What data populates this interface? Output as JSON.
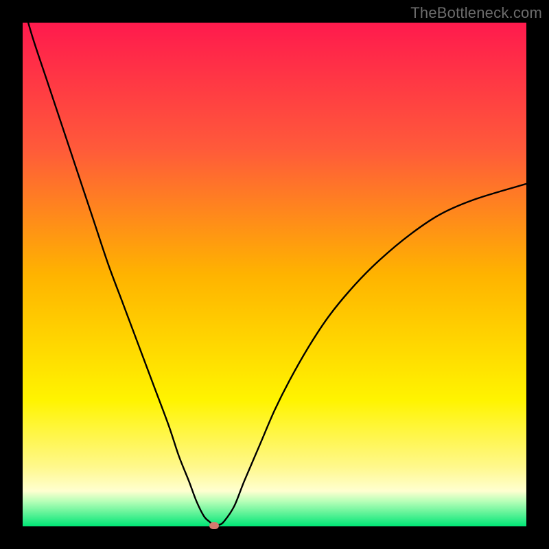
{
  "watermark": "TheBottleneck.com",
  "chart_data": {
    "type": "line",
    "title": "",
    "xlabel": "",
    "ylabel": "",
    "xlim": [
      0,
      100
    ],
    "ylim": [
      0,
      100
    ],
    "x": [
      0,
      2,
      5,
      8,
      11,
      14,
      17,
      20,
      23,
      26,
      29,
      31,
      33,
      34.5,
      36,
      37,
      38,
      39,
      40,
      42,
      44,
      47,
      50,
      53,
      57,
      61,
      66,
      71,
      77,
      83,
      90,
      100
    ],
    "values": [
      104,
      97,
      88,
      79,
      70,
      61,
      52,
      44,
      36,
      28,
      20,
      14,
      9,
      5,
      2,
      1,
      0.2,
      0.3,
      1,
      4,
      9,
      16,
      23,
      29,
      36,
      42,
      48,
      53,
      58,
      62,
      65,
      68
    ],
    "minimum_marker": {
      "x": 38,
      "y": 0.2
    },
    "background_gradient": {
      "top_color": "#ff1a4d",
      "bottom_color": "#00e676"
    }
  }
}
